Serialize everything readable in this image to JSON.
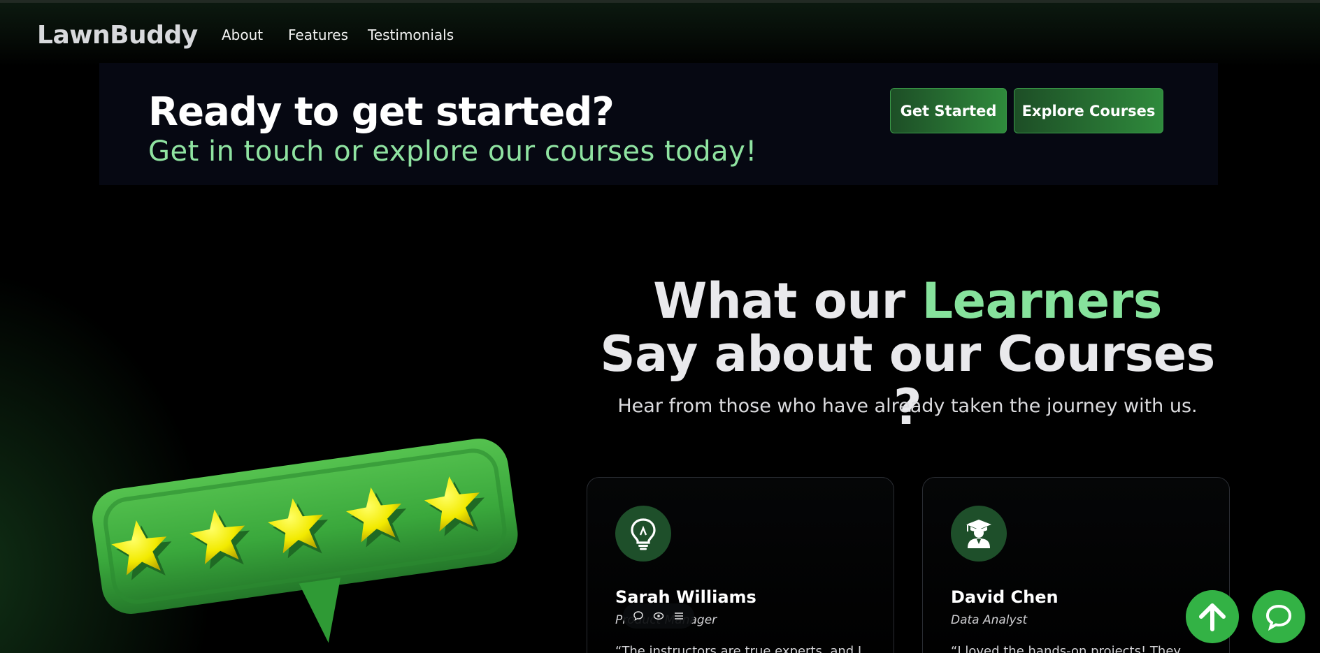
{
  "brand": {
    "name": "LawnBuddy"
  },
  "nav": {
    "items": [
      {
        "label": "About"
      },
      {
        "label": "Features"
      },
      {
        "label": "Testimonials"
      }
    ]
  },
  "cta": {
    "title": "Ready to get started?",
    "subtitle": "Get in touch or explore our courses today!",
    "buttons": {
      "get_started": "Get Started",
      "explore": "Explore Courses"
    }
  },
  "testimonials": {
    "heading_before": "What our ",
    "heading_accent": "Learners",
    "heading_after": " Say about our Courses ?",
    "subheading": "Hear from those who have already taken the journey with us.",
    "cards": [
      {
        "name": "Sarah Williams",
        "role": "Product Manager",
        "icon": "lightbulb-icon",
        "quote": "“The instructors are true experts, and I"
      },
      {
        "name": "David Chen",
        "role": "Data Analyst",
        "icon": "graduate-icon",
        "quote": "“I loved the hands-on projects! They"
      }
    ]
  },
  "rating": {
    "stars": 5,
    "max": 5
  },
  "colors": {
    "accent": "#86e29c",
    "brand_green": "#33b245",
    "banner_bg": "#060812",
    "icon_bg": "#1e4f2a"
  },
  "fabs": {
    "scroll_top": "arrow-up-icon",
    "chat": "chat-icon"
  }
}
